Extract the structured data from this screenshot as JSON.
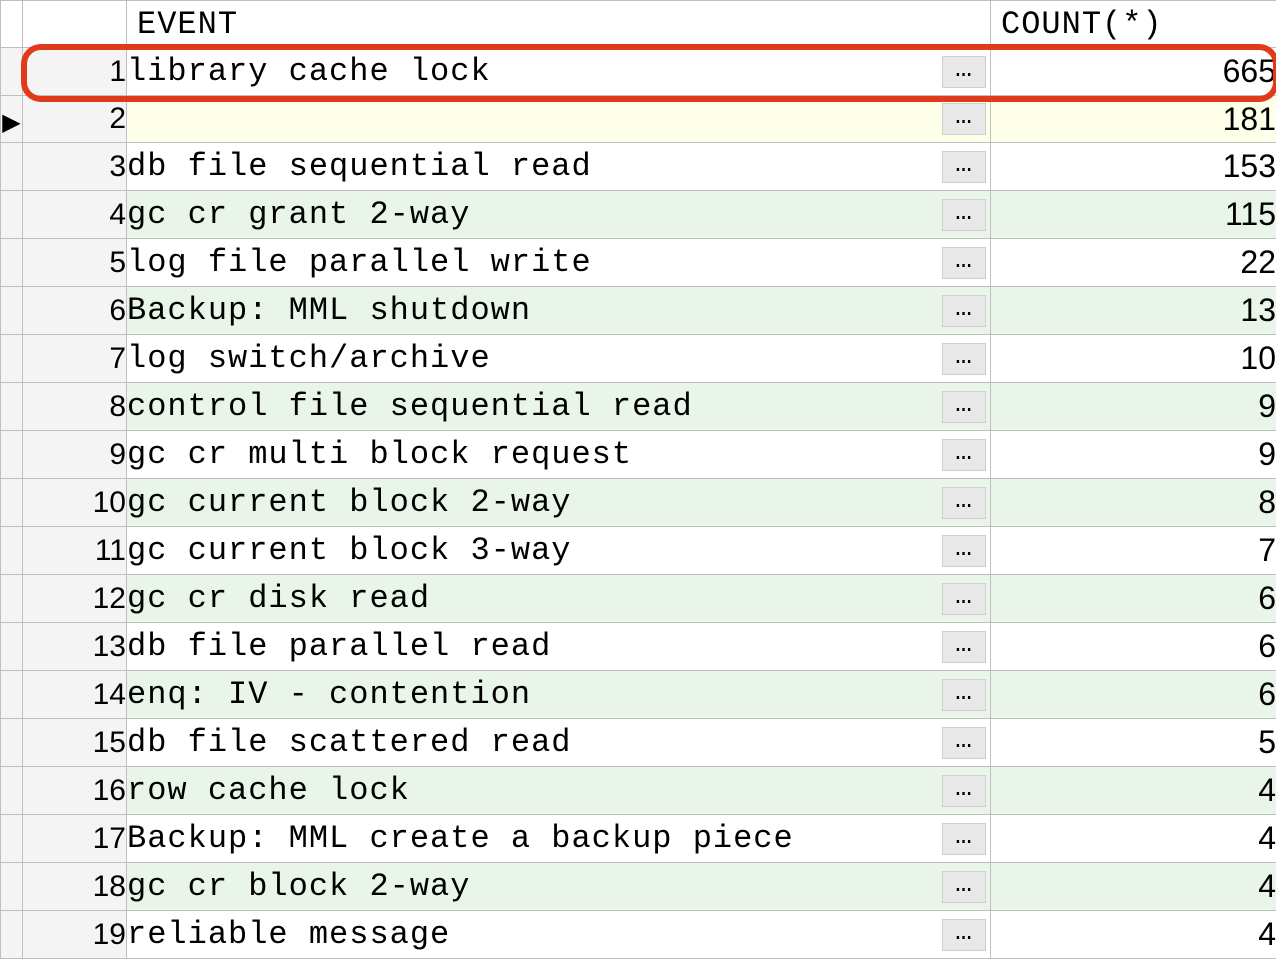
{
  "headers": {
    "event": "EVENT",
    "count": "COUNT(*)"
  },
  "ellipsis_label": "…",
  "highlighted_row_index": 0,
  "current_row_index": 1,
  "rows": [
    {
      "n": "1",
      "event": "library cache lock",
      "count": "665",
      "alt": false
    },
    {
      "n": "2",
      "event": "",
      "count": "181",
      "alt": true
    },
    {
      "n": "3",
      "event": "db file sequential read",
      "count": "153",
      "alt": false
    },
    {
      "n": "4",
      "event": "gc cr grant 2-way",
      "count": "115",
      "alt": true
    },
    {
      "n": "5",
      "event": "log file parallel write",
      "count": "22",
      "alt": false
    },
    {
      "n": "6",
      "event": "Backup: MML shutdown",
      "count": "13",
      "alt": true
    },
    {
      "n": "7",
      "event": "log switch/archive",
      "count": "10",
      "alt": false
    },
    {
      "n": "8",
      "event": "control file sequential read",
      "count": "9",
      "alt": true
    },
    {
      "n": "9",
      "event": "gc cr multi block request",
      "count": "9",
      "alt": false
    },
    {
      "n": "10",
      "event": "gc current block 2-way",
      "count": "8",
      "alt": true
    },
    {
      "n": "11",
      "event": "gc current block 3-way",
      "count": "7",
      "alt": false
    },
    {
      "n": "12",
      "event": "gc cr disk read",
      "count": "6",
      "alt": true
    },
    {
      "n": "13",
      "event": "db file parallel read",
      "count": "6",
      "alt": false
    },
    {
      "n": "14",
      "event": "enq: IV -  contention",
      "count": "6",
      "alt": true
    },
    {
      "n": "15",
      "event": "db file scattered read",
      "count": "5",
      "alt": false
    },
    {
      "n": "16",
      "event": "row cache lock",
      "count": "4",
      "alt": true
    },
    {
      "n": "17",
      "event": "Backup: MML create a backup piece",
      "count": "4",
      "alt": false
    },
    {
      "n": "18",
      "event": "gc cr block 2-way",
      "count": "4",
      "alt": true
    },
    {
      "n": "19",
      "event": "reliable message",
      "count": "4",
      "alt": false
    }
  ]
}
